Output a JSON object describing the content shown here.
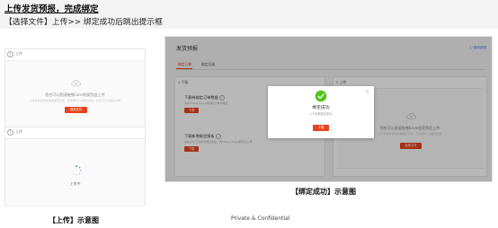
{
  "header": {
    "title": "上传发货预报，完成绑定",
    "subtitle": "【选择文件】上传>> 绑定成功后跳出提示框"
  },
  "upload_panel": {
    "step_no": "1",
    "step_label": "上传",
    "drop_text": "您也可以直接拖拽Excel档案到此上传",
    "drop_hint": "上传文件前请先选择绑定文件，仅支持Excel格式文档，文件大小不超过2MB",
    "button": "选择文件"
  },
  "uploading_panel": {
    "step_no": "1",
    "step_label": "上传",
    "status": "上传中"
  },
  "caption_left": "【上传】示意图",
  "caption_right": "【绑定成功】示意图",
  "footer": "Private & Confidential",
  "screen": {
    "app_title": "发货预报",
    "help_link": "使用说明",
    "tabs": [
      {
        "label": "绑定订单",
        "active": true
      },
      {
        "label": "绑定记录",
        "active": false
      }
    ],
    "download_card": {
      "step_no": "1",
      "label": "下载",
      "item1_title": "下载待绑定订单数据",
      "item1_desc": "请在Fbaup Slepe待绑定订单中导出",
      "item1_button": "下载",
      "item2_title": "下载新增绑定模板",
      "item2_desc": "请在此处下载新增绑定模板，按Fbaup Slepe填写后上传",
      "item2_button": "下载"
    },
    "upload_card": {
      "step_no": "2",
      "label": "上传",
      "drop_text": "您也可以直接拖拽Excel档案到此上传",
      "drop_hint": "上传文件前请先选择绑定文件，仅支持Excel格式文档",
      "button": "选择文件"
    },
    "modal": {
      "title": "绑定成功",
      "subtitle": "1个包裹绑定成功",
      "button": "下载"
    }
  },
  "colors": {
    "accent": "#e8431f",
    "success": "#52c41a",
    "link": "#4a7bd0"
  }
}
